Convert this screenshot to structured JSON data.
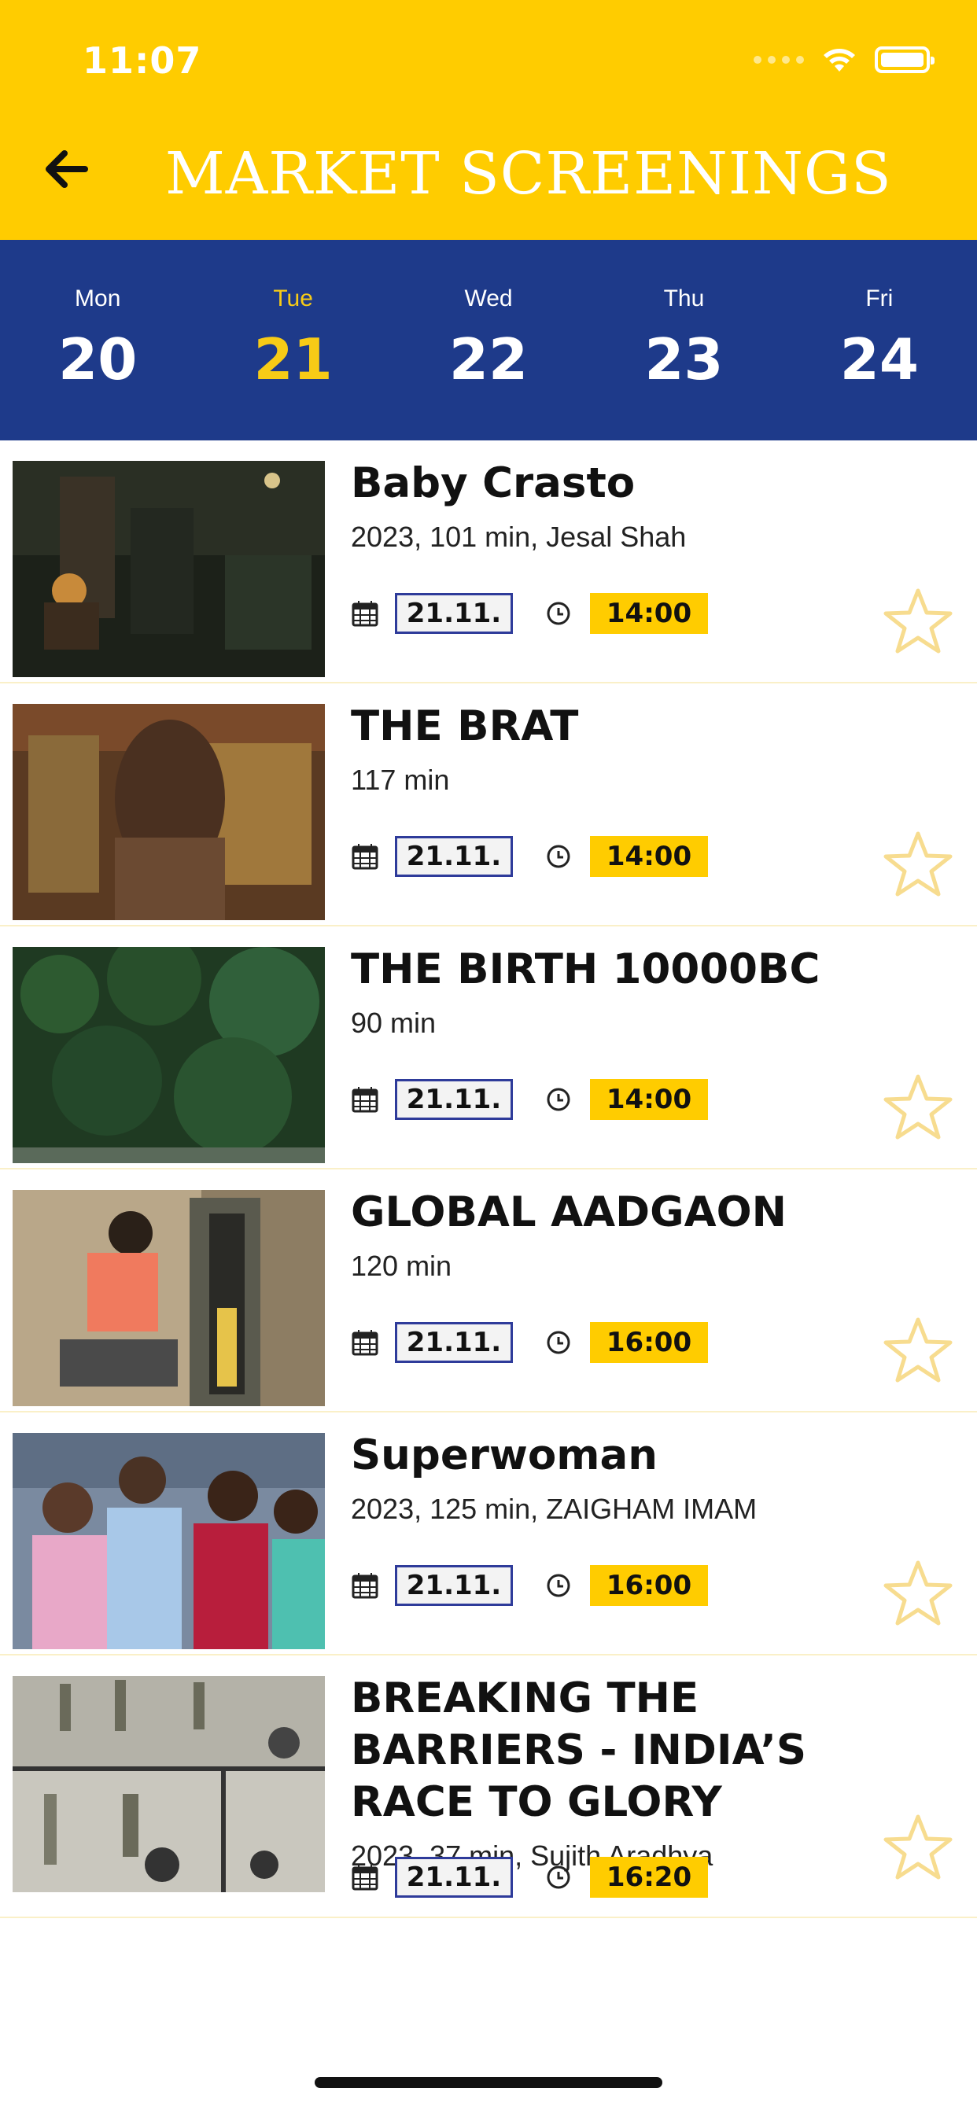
{
  "status": {
    "time": "11:07"
  },
  "header": {
    "title": "MARKET SCREENINGS",
    "back_icon": "arrow-left-icon"
  },
  "colors": {
    "header_bg": "#FFCC00",
    "daybar_bg": "#1E3A8A",
    "active_day": "#F7CB16",
    "date_border": "#2E3B9A",
    "time_bg": "#FFCC00",
    "star": "#F7DC8F"
  },
  "days": [
    {
      "name": "Mon",
      "num": "20",
      "active": false
    },
    {
      "name": "Tue",
      "num": "21",
      "active": true
    },
    {
      "name": "Wed",
      "num": "22",
      "active": false
    },
    {
      "name": "Thu",
      "num": "23",
      "active": false
    },
    {
      "name": "Fri",
      "num": "24",
      "active": false
    }
  ],
  "films": [
    {
      "title": "Baby Crasto",
      "meta": "2023, 101 min, Jesal Shah",
      "date": "21.11.",
      "time": "14:00"
    },
    {
      "title": "THE BRAT",
      "meta": "117 min",
      "date": "21.11.",
      "time": "14:00"
    },
    {
      "title": "THE BIRTH 10000BC",
      "meta": "90 min",
      "date": "21.11.",
      "time": "14:00"
    },
    {
      "title": "GLOBAL AADGAON",
      "meta": "120 min",
      "date": "21.11.",
      "time": "16:00"
    },
    {
      "title": "Superwoman",
      "meta": "2023, 125 min, ZAIGHAM IMAM",
      "date": "21.11.",
      "time": "16:00"
    },
    {
      "title": "BREAKING THE BARRIERS - INDIA’S RACE TO GLORY",
      "meta": "2023, 37 min, Sujith Aradhya",
      "date": "21.11.",
      "time": "16:20"
    }
  ]
}
